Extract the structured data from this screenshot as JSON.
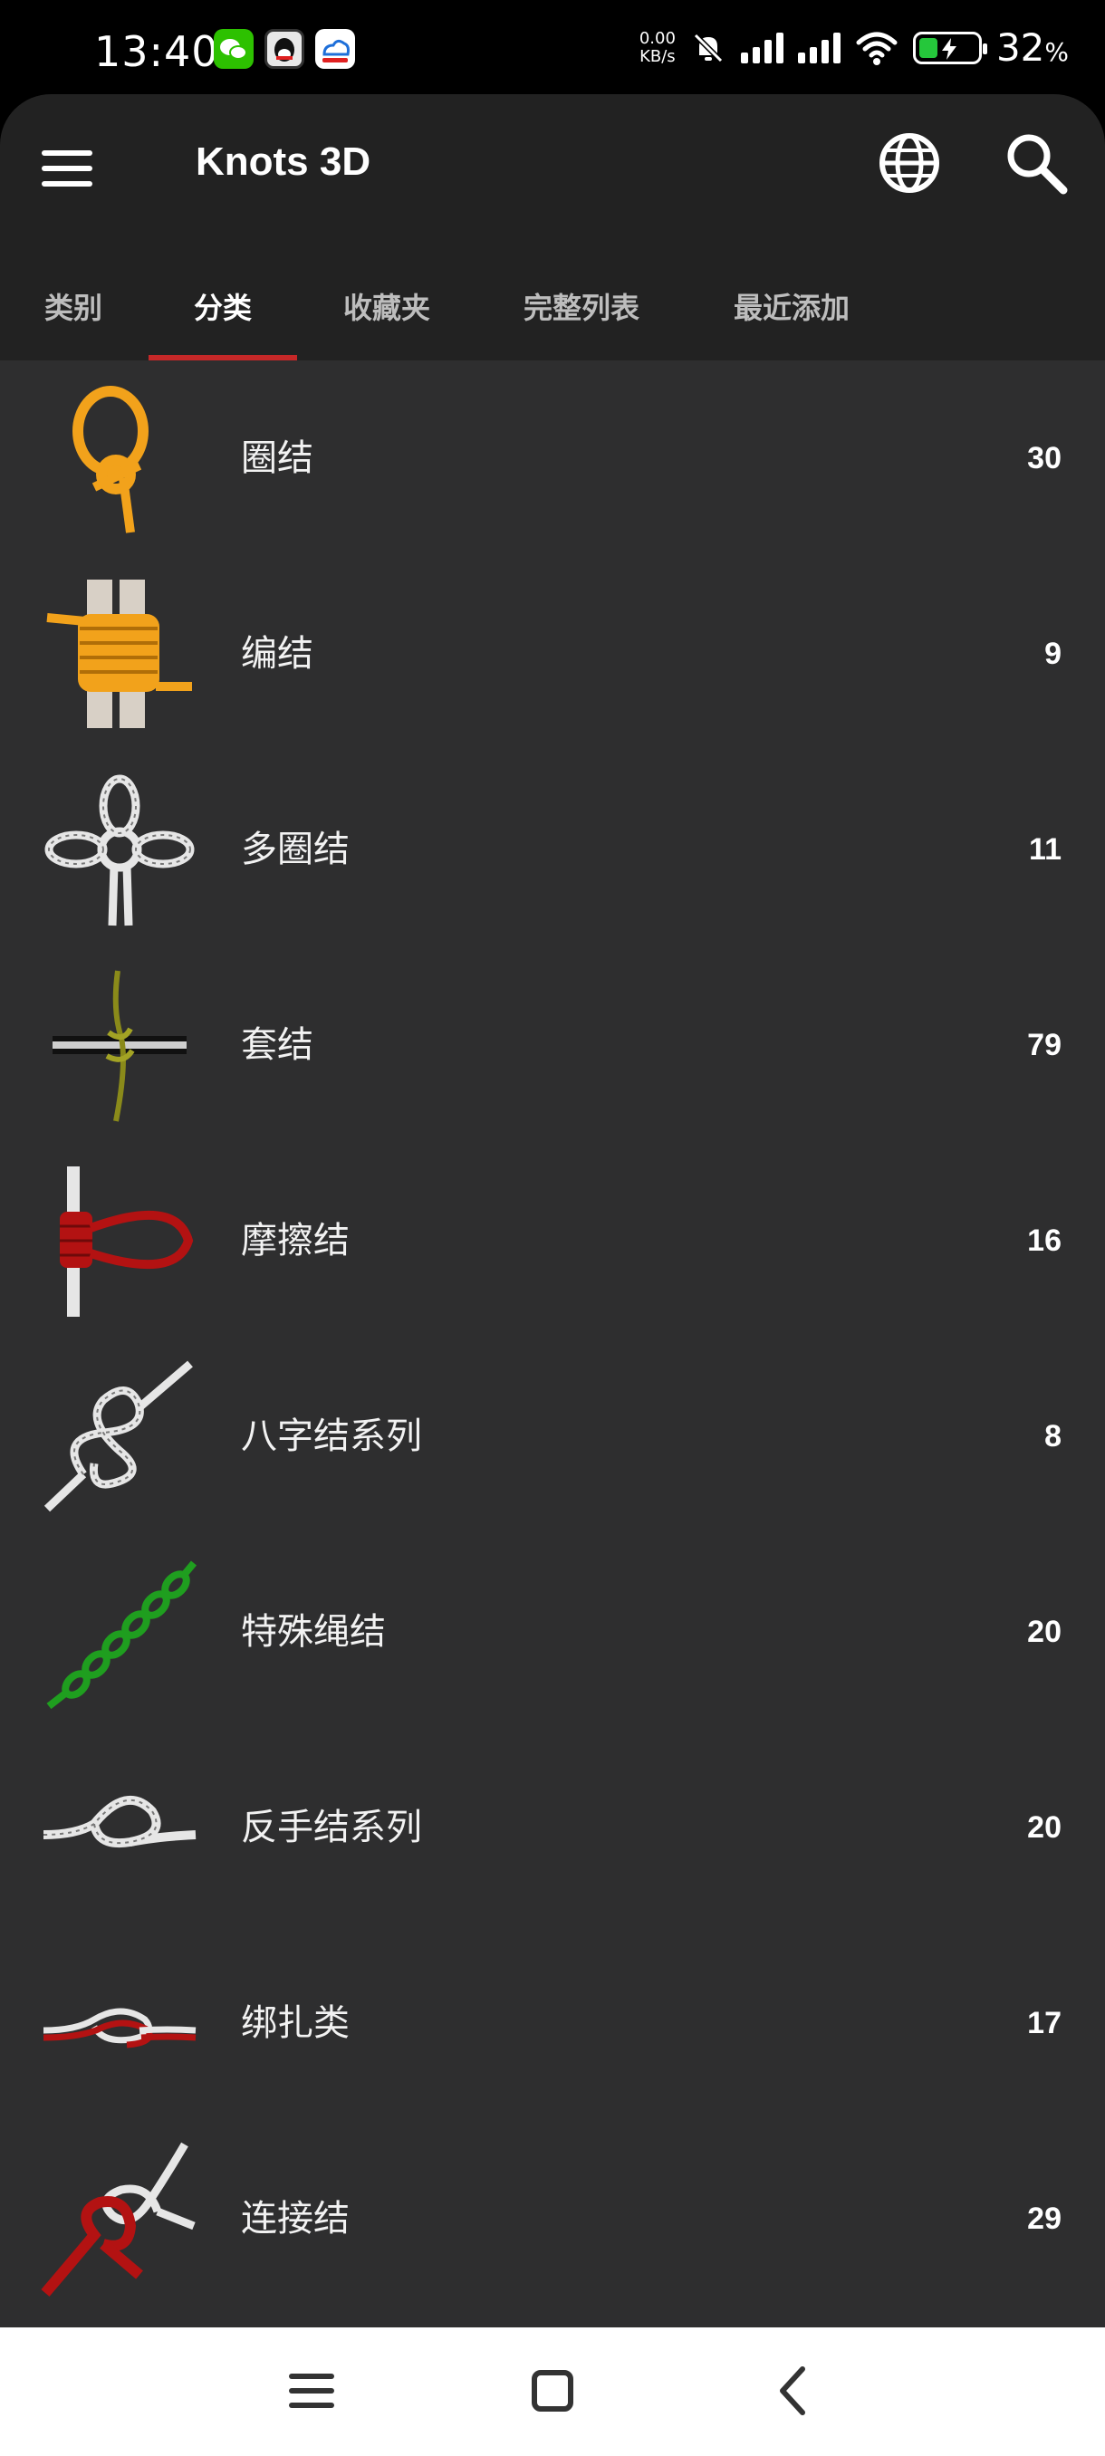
{
  "status_bar": {
    "time": "13:40",
    "net_speed_value": "0.00",
    "net_speed_unit": "KB/s",
    "battery_percent": "32",
    "battery_percent_sign": "%",
    "notification_icons": [
      "wechat-icon",
      "qq-icon",
      "cloud-app-icon"
    ],
    "status_icons": [
      "mute-icon",
      "signal-icon",
      "signal-icon",
      "wifi-icon",
      "battery-charging-icon"
    ]
  },
  "app_bar": {
    "title": "Knots 3D",
    "icons": [
      "menu-icon",
      "globe-icon",
      "search-icon"
    ]
  },
  "tabs": [
    {
      "label": "类别",
      "active": false
    },
    {
      "label": "分类",
      "active": true
    },
    {
      "label": "收藏夹",
      "active": false
    },
    {
      "label": "完整列表",
      "active": false
    },
    {
      "label": "最近添加",
      "active": false
    }
  ],
  "categories": [
    {
      "name": "圈结",
      "count": "30",
      "icon": "loop-knot-icon",
      "color": "#f2a21b"
    },
    {
      "name": "编结",
      "count": "9",
      "icon": "binding-knot-icon",
      "color": "#f2a21b"
    },
    {
      "name": "多圈结",
      "count": "11",
      "icon": "multi-loop-knot-icon",
      "color": "#e6e6e6"
    },
    {
      "name": "套结",
      "count": "79",
      "icon": "hitch-knot-icon",
      "color": "#8a8a1a"
    },
    {
      "name": "摩擦结",
      "count": "16",
      "icon": "friction-knot-icon",
      "color": "#b31212"
    },
    {
      "name": "八字结系列",
      "count": "8",
      "icon": "figure-eight-knot-icon",
      "color": "#e6e6e6"
    },
    {
      "name": "特殊绳结",
      "count": "20",
      "icon": "special-knot-icon",
      "color": "#1f9e1f"
    },
    {
      "name": "反手结系列",
      "count": "20",
      "icon": "overhand-knot-icon",
      "color": "#e6e6e6"
    },
    {
      "name": "绑扎类",
      "count": "17",
      "icon": "lashing-knot-icon",
      "color": "#b31212"
    },
    {
      "name": "连接结",
      "count": "29",
      "icon": "bend-knot-icon",
      "color": "#b31212"
    }
  ],
  "colors": {
    "status_bar_bg": "#000000",
    "app_bar_bg": "#222222",
    "list_bg": "#2e2e2f",
    "tab_indicator": "#c62828",
    "nav_bar_bg": "#ffffff"
  },
  "nav_bar": {
    "icons": [
      "recents-menu-icon",
      "home-square-icon",
      "back-chevron-icon"
    ]
  }
}
